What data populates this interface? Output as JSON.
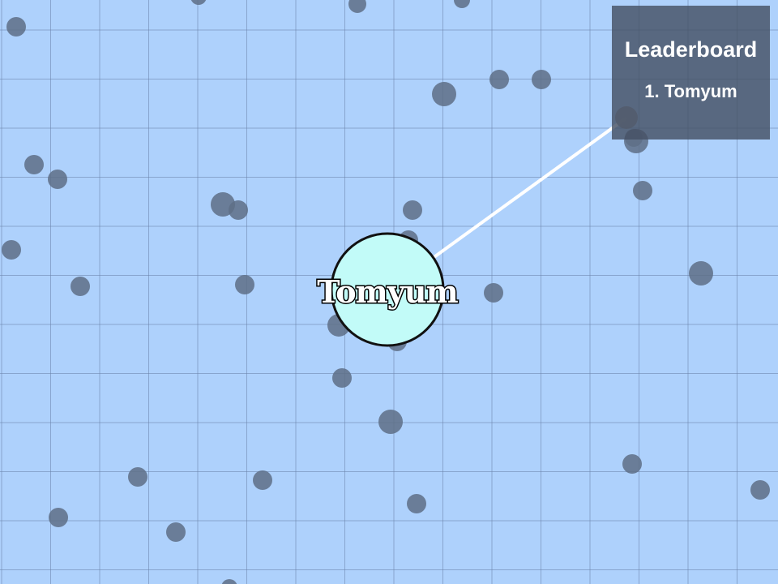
{
  "game": {
    "background_color": "#aed1fc",
    "grid_color": "#6a82a8",
    "pellet_color": "#5e6e86",
    "player_color": "#c2fbf8",
    "player_outline_color": "#111111",
    "aim_line_color": "#ffffff"
  },
  "player": {
    "name": "Tomyum"
  },
  "leaderboard": {
    "title": "Leaderboard",
    "entries": [
      "1. Tomyum"
    ]
  }
}
